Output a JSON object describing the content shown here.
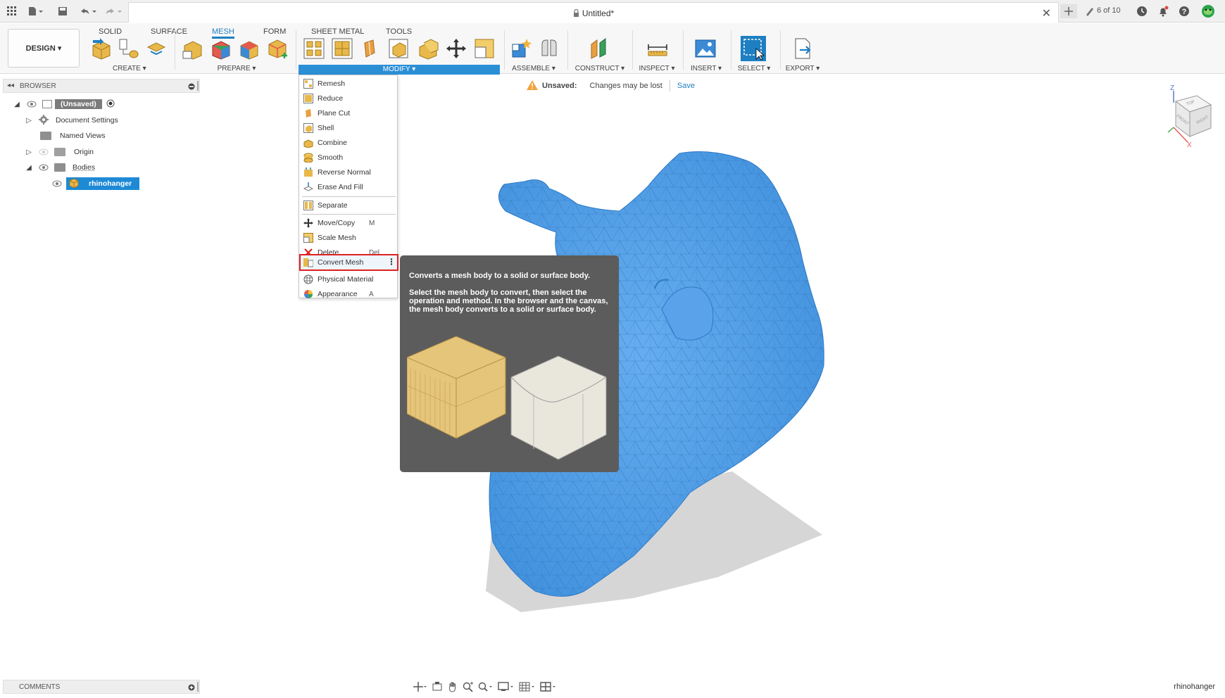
{
  "titlebar": {
    "doc_title": "Untitled*",
    "step_count": "6 of 10"
  },
  "toolbar": {
    "design_label": "DESIGN ▾",
    "tabs": [
      {
        "label": "SOLID"
      },
      {
        "label": "SURFACE"
      },
      {
        "label": "MESH"
      },
      {
        "label": "FORM"
      },
      {
        "label": "SHEET METAL"
      },
      {
        "label": "TOOLS"
      }
    ],
    "groups": {
      "create": "CREATE ▾",
      "prepare": "PREPARE ▾",
      "modify": "MODIFY ▾",
      "assemble": "ASSEMBLE ▾",
      "construct": "CONSTRUCT ▾",
      "inspect": "INSPECT ▾",
      "insert": "INSERT ▾",
      "select": "SELECT ▾",
      "export": "EXPORT ▾"
    }
  },
  "browser": {
    "header": "BROWSER",
    "items": [
      {
        "label": "(Unsaved)"
      },
      {
        "label": "Document Settings"
      },
      {
        "label": "Named Views"
      },
      {
        "label": "Origin"
      },
      {
        "label": "Bodies"
      },
      {
        "label": "rhinohanger"
      }
    ]
  },
  "warning": {
    "label": "Unsaved:",
    "message": "Changes may be lost",
    "save": "Save"
  },
  "modify_menu": {
    "items": [
      {
        "label": "Remesh",
        "key": ""
      },
      {
        "label": "Reduce",
        "key": ""
      },
      {
        "label": "Plane Cut",
        "key": ""
      },
      {
        "label": "Shell",
        "key": ""
      },
      {
        "label": "Combine",
        "key": ""
      },
      {
        "label": "Smooth",
        "key": ""
      },
      {
        "label": "Reverse Normal",
        "key": ""
      },
      {
        "label": "Erase And Fill",
        "key": ""
      },
      {
        "label": "Separate",
        "key": ""
      },
      {
        "label": "Move/Copy",
        "key": "M"
      },
      {
        "label": "Scale Mesh",
        "key": ""
      },
      {
        "label": "Delete",
        "key": "Del"
      },
      {
        "label": "Convert Mesh",
        "key": ""
      },
      {
        "label": "Physical Material",
        "key": ""
      },
      {
        "label": "Appearance",
        "key": "A"
      }
    ]
  },
  "tooltip": {
    "title": "Converts a mesh body to a solid or surface body.",
    "body": "Select the mesh body to convert, then select the operation and method. In the browser and the canvas, the mesh body converts to a solid or surface body."
  },
  "viewcube": {
    "top": "TOP",
    "front": "FRONT",
    "right": "RIGHT",
    "z": "Z",
    "x": "X"
  },
  "comments": {
    "label": "COMMENTS"
  },
  "status": {
    "body_name": "rhinohanger"
  },
  "colors": {
    "accent": "#2b8fd6",
    "mesh_body": "#4a9be3",
    "tooltip_bg": "#5c5c5c",
    "highlight_border": "#e02020"
  }
}
